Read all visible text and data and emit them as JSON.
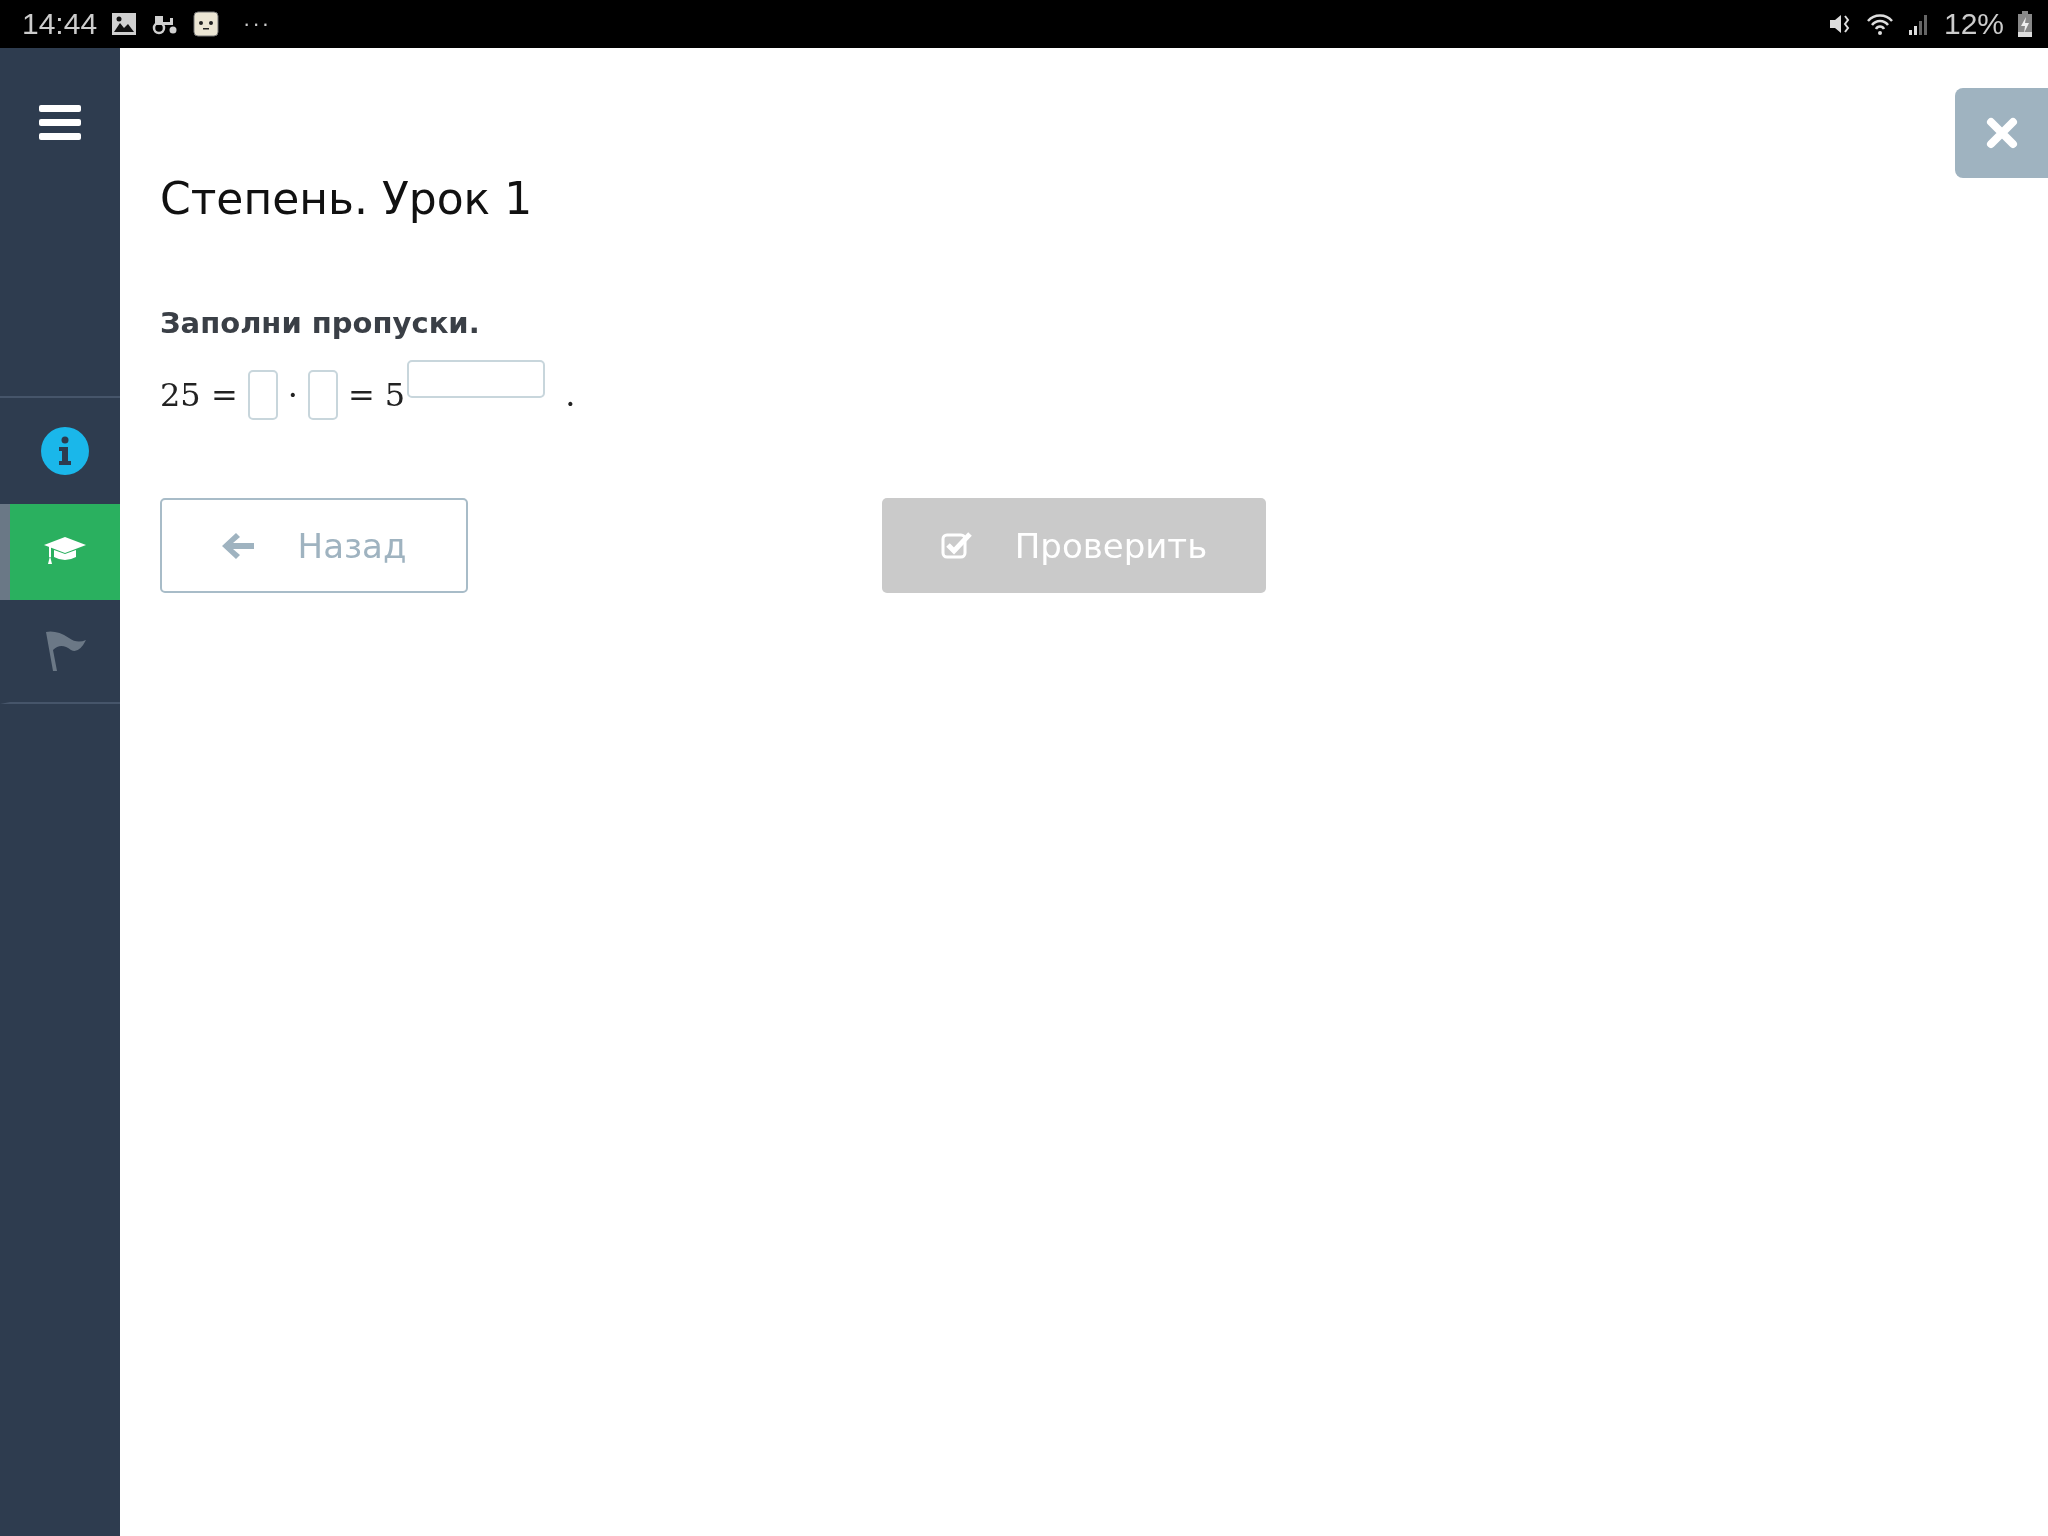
{
  "status_bar": {
    "time": "14:44",
    "more": "···",
    "battery": "12%"
  },
  "sidebar": {
    "items": [
      {
        "kind": "menu",
        "selected": false
      },
      {
        "kind": "info",
        "selected": false
      },
      {
        "kind": "lesson",
        "selected": true
      },
      {
        "kind": "flag",
        "selected": false
      }
    ]
  },
  "title": "Степень. Урок 1",
  "instruction": "Заполни пропуски.",
  "equation": [
    {
      "kind": "text",
      "text": "25 ="
    },
    {
      "kind": "blank"
    },
    {
      "kind": "text",
      "text": "·"
    },
    {
      "kind": "blank"
    },
    {
      "kind": "text",
      "text": "= 5"
    },
    {
      "kind": "exponent_blank"
    },
    {
      "kind": "text",
      "text": "."
    }
  ],
  "buttons": [
    {
      "kind": "back",
      "label": "Назад",
      "disabled": false
    },
    {
      "kind": "check",
      "label": "Проверить",
      "disabled": true
    }
  ]
}
